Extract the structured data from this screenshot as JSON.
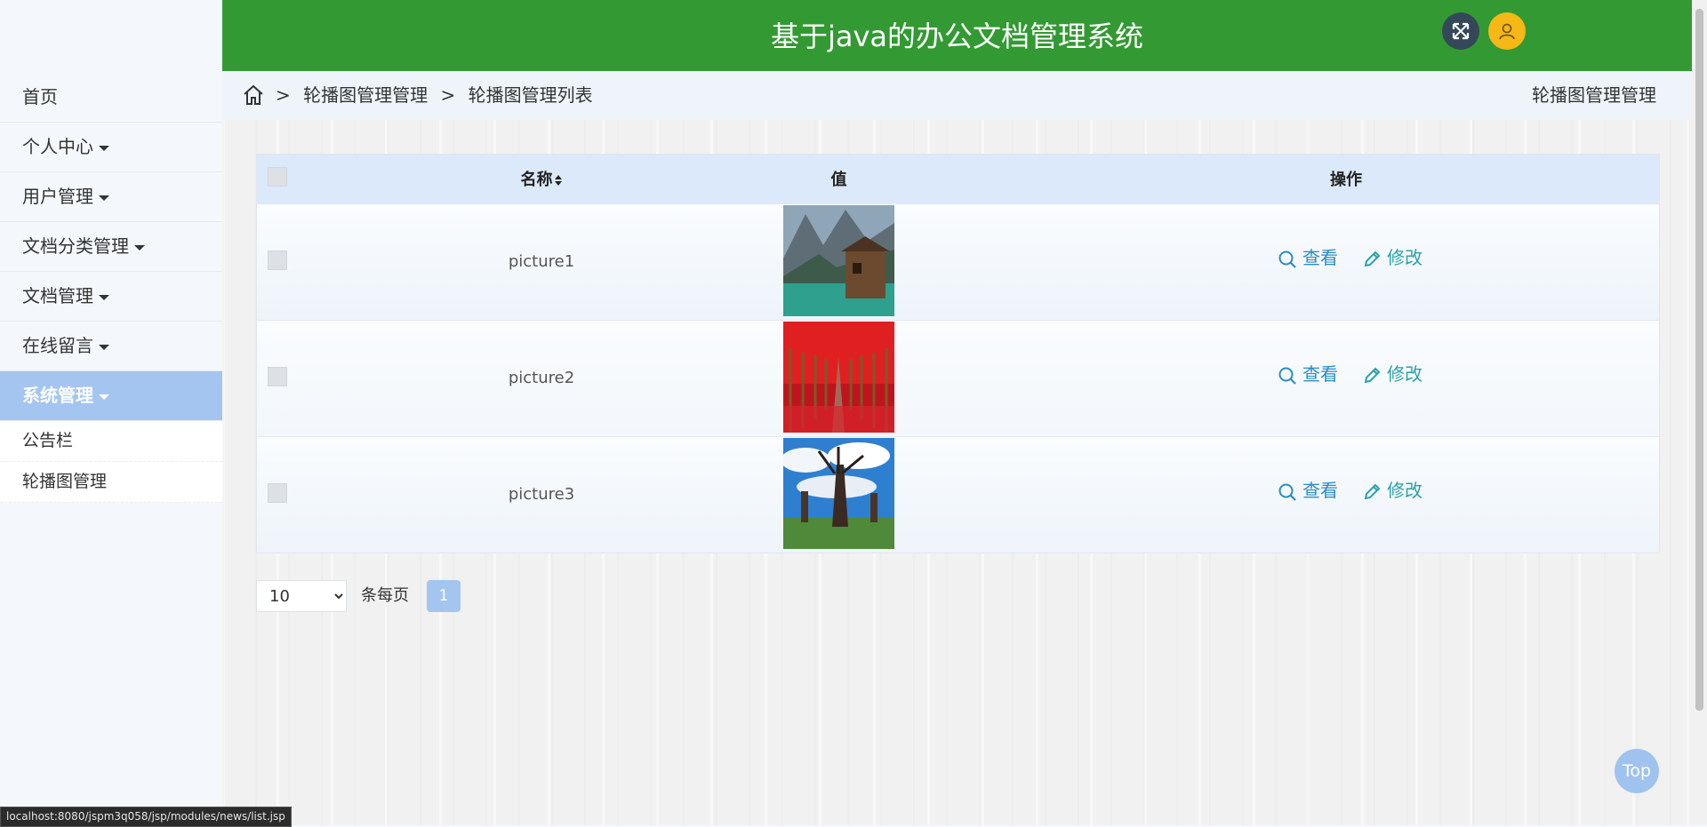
{
  "header": {
    "title": "基于java的办公文档管理系统"
  },
  "sidebar": {
    "items": [
      {
        "label": "首页",
        "has_caret": false
      },
      {
        "label": "个人中心",
        "has_caret": true
      },
      {
        "label": "用户管理",
        "has_caret": true
      },
      {
        "label": "文档分类管理",
        "has_caret": true
      },
      {
        "label": "文档管理",
        "has_caret": true
      },
      {
        "label": "在线留言",
        "has_caret": true
      },
      {
        "label": "系统管理",
        "has_caret": true,
        "active": true
      }
    ],
    "subitems": [
      "公告栏",
      "轮播图管理"
    ]
  },
  "breadcrumb": {
    "sep": ">",
    "level1": "轮播图管理管理",
    "level2": "轮播图管理列表",
    "right_title": "轮播图管理管理"
  },
  "table": {
    "columns": [
      "名称",
      "值",
      "操作"
    ],
    "rows": [
      {
        "name": "picture1",
        "image": "mountain-lake-cabin"
      },
      {
        "name": "picture2",
        "image": "red-tree-avenue"
      },
      {
        "name": "picture3",
        "image": "windmills-blue-sky"
      }
    ],
    "view_label": "查看",
    "edit_label": "修改"
  },
  "pager": {
    "page_size": "10",
    "per_page_label": "条每页",
    "current_page": "1"
  },
  "top_button": "Top",
  "status_url": "localhost:8080/jspm3q058/jsp/modules/news/list.jsp",
  "colors": {
    "header_bg": "#339a33",
    "active_menu": "#a4c5ef",
    "user_btn": "#f5b817",
    "fullscreen_btn": "#35485a"
  }
}
